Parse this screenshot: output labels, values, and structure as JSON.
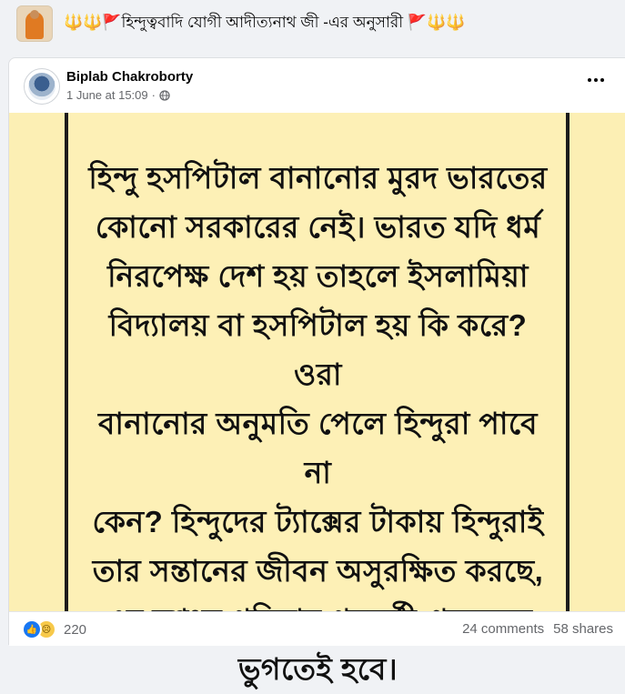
{
  "group": {
    "title": "🔱🔱🚩হিন্দুত্ববাদি যোগী আদীত্যনাথ জী -এর অনুসারী 🚩🔱🔱"
  },
  "post": {
    "author": "Biplab Chakroborty",
    "timestamp": "1 June at 15:09",
    "separator": "·",
    "privacy_icon": "globe-icon",
    "image_lines": [
      "হিন্দু হসপিটাল বানানোর মুরদ ভারতের",
      "কোনো সরকারের নেই। ভারত যদি ধর্ম",
      "নিরপেক্ষ দেশ হয় তাহলে ইসলামিয়া",
      "বিদ্যালয় বা হসপিটাল হয় কি করে? ওরা",
      "বানানোর অনুমতি পেলে হিন্দুরা পাবে না",
      "কেন? হিন্দুদের ট্যাক্সের টাকায় হিন্দুরাই",
      "তার সন্তানের জীবন অসুরক্ষিত করছে,",
      "এর নৃশংস পরিনাম পরবর্তী প্রজন্মকে",
      "ভুগতেই হবে।"
    ],
    "image_bg_color": "#fcefb4",
    "reaction_icons": [
      "like-icon",
      "sad-icon"
    ],
    "reaction_count": "220",
    "comments": "24 comments",
    "shares": "58 shares"
  }
}
